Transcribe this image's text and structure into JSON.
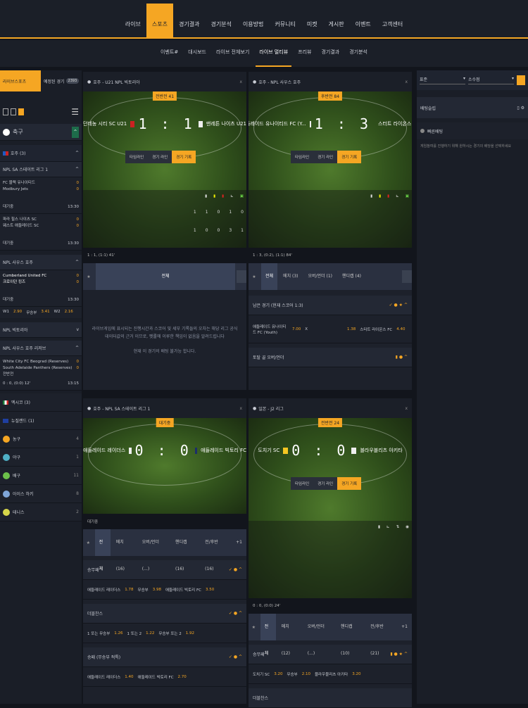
{
  "topnav": {
    "items": [
      "라이브",
      "스포츠",
      "경기결과",
      "경기분석",
      "이용방법",
      "커뮤니티",
      "미켓",
      "게시판",
      "이벤트",
      "고객센터"
    ]
  },
  "subnav": {
    "items": [
      "이벤트#",
      "대시보드",
      "라이브 전체보기",
      "라이브 멀티뷰",
      "프리뷰",
      "경기결과",
      "경기분석"
    ]
  },
  "left": {
    "tab_live": "라이브스포츠",
    "tab_upcoming": "예정된 경기",
    "tab_count": "2393",
    "soccer": "축구",
    "region_au": "호주 (3)",
    "league1": "NPL SA 스테이트 리그 1",
    "m1": {
      "home": "FC 블랙 유나이티드",
      "away": "Modbury Jets",
      "hs": "0",
      "as": "0",
      "status": "대기중",
      "time": "13:30"
    },
    "m2": {
      "home": "파라 힐스 나이츠 SC",
      "away": "웨스트 애들레이드 SC",
      "hs": "0",
      "as": "0",
      "status": "대기중",
      "time": "13:30"
    },
    "league2": "NPL 사우스 호주",
    "m3": {
      "home": "Cumberland United FC",
      "away": "크로이던 킹즈",
      "hs": "0",
      "as": "0",
      "status": "대기중",
      "time": "13:30"
    },
    "odds": {
      "w1": "W1",
      "v1": "2.90",
      "x": "무승부",
      "vx": "3.41",
      "w2": "W2",
      "v2": "2.16"
    },
    "league3": "NPL 빅토리아",
    "league4": "NPL 사우스 호주 리저브",
    "m4": {
      "home": "White City FC Beograd (Reserves)",
      "away": "South Adelaide Panthers (Reserves)",
      "hs": "0",
      "as": "0",
      "status": "전반전",
      "time": "13:15",
      "score": "0 : 0, (0:0) 12'"
    },
    "regions": [
      {
        "name": "멕시코 (3)"
      },
      {
        "name": "뉴질랜드 (1)"
      }
    ],
    "sports": [
      {
        "name": "농구",
        "n": "4"
      },
      {
        "name": "야구",
        "n": "1"
      },
      {
        "name": "배구",
        "n": "11"
      },
      {
        "name": "아이스 하키",
        "n": "8"
      },
      {
        "name": "테니스",
        "n": "2"
      }
    ]
  },
  "p1": {
    "title": "호주 - U21 NPL 빅토리아",
    "badge": "전반전 41",
    "home": "던데농 시티 SC U21",
    "away": "맨레튼 나이츠 U21",
    "score": "1 : 1",
    "tab1": "타임라인",
    "tab2": "경기 라인",
    "tab3": "경기 기록",
    "h1": "0",
    "h2": "1",
    "h3": "0",
    "h4": "0",
    "a1": "1",
    "a2": "0",
    "a3": "0",
    "a4": "3",
    "a5": "1",
    "hx": "1",
    "info": "1 : 1, (1:1) 41'",
    "mt": "전체",
    "msg": "라이브게임에 표시되는 진행시간과 스코어 및 세부 기록들의 오차는 해당 리그 공식 데이터값의 근거 이므로, 펫롤에 이루한 책임이 없음을 알려드립니다",
    "msg2": "현재 이 경기의 배팅 불가능 합니다."
  },
  "p2": {
    "title": "호주 - NPL 사우스 호주",
    "badge": "후반전 84",
    "home": "애들레이드 유나이티드 FC (Y...",
    "away": "스터트 라이온스 FC",
    "score": "1 : 3",
    "tab1": "타임라인",
    "tab2": "경기 라인",
    "tab3": "경기 기록",
    "info": "1 : 3, (0:2), (1:1) 84'",
    "tabs": [
      "전체",
      "메치 (3)",
      "오버/언더 (1)",
      "핸디캡 (4)"
    ],
    "mk1": "남은 경기 (현재 스코어 1:3)",
    "oh": "애들레이드 유나이티드 FC (Youth)",
    "ov1": "7.00",
    "ox": "X",
    "ov2": "1.38",
    "oa": "스터트 라이온스 FC",
    "ov3": "4.40",
    "mk2": "토탈 골 오버/언더"
  },
  "p3": {
    "title": "호주 - NPL SA 스테이트 리그 1",
    "badge": "대기중",
    "home": "애들레이드 레이더스",
    "away": "애들레이드 빅토리 FC",
    "score": "0 : 0",
    "info": "대기중",
    "tabs": [
      "전체",
      "메치 (16)",
      "오버/언더 (...)",
      "핸디캡 (16)",
      "전/후반 (16)",
      "+1"
    ],
    "mk1": "승무패",
    "r1": [
      "애들레이드 레이더스",
      "1.78",
      "무승부",
      "3.98",
      "애들레이드 빅토리 FC",
      "3.50"
    ],
    "mk2": "더블찬스",
    "r2": [
      "1 또는 무승부",
      "1.26",
      "1 또는 2",
      "1.22",
      "무승부 또는 2",
      "1.92"
    ],
    "mk3": "승패 (무승부 적특)",
    "r3": [
      "애들레이드 레이더스",
      "1.40",
      "애들레이드 빅토리 FC",
      "2.70"
    ]
  },
  "p4": {
    "title": "일본 - J2 리그",
    "badge": "전반전 24",
    "home": "도치기 SC",
    "away": "블라우블리츠 아키타",
    "score": "0 : 0",
    "tab1": "타임라인",
    "tab2": "경기 라인",
    "tab3": "경기 기록",
    "info": "0 : 0, (0:0) 24'",
    "tabs": [
      "전체",
      "메치 (12)",
      "오버/언더 (...)",
      "핸디캡 (10)",
      "전/후반 (21)",
      "+1"
    ],
    "mk1": "승무패",
    "r1": [
      "도치기 SC",
      "3.20",
      "무승부",
      "2.10",
      "블라우블리츠 아키타",
      "3.20"
    ],
    "mk2": "더블찬스"
  },
  "right": {
    "sel1": "표준",
    "sel2": "소수점",
    "head": "배팅슬립",
    "sec": "빠른배팅",
    "info": "게임참여를 진행하기 위해 원하시는 경기의 배당을 선택하세요"
  }
}
